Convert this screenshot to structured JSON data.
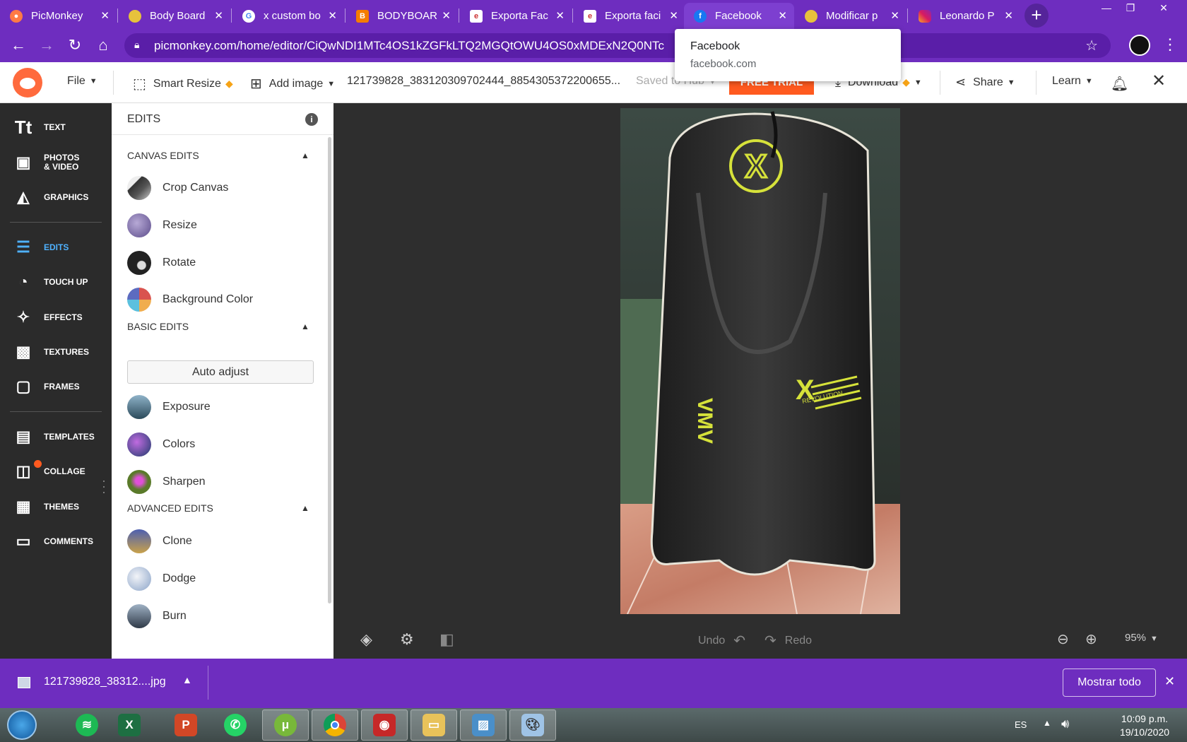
{
  "browser": {
    "tabs": [
      {
        "title": "PicMonkey",
        "favicon": "picmonkey-icon",
        "active": false
      },
      {
        "title": "Body Board",
        "favicon": "monkey-icon",
        "active": false
      },
      {
        "title": "x custom bo",
        "favicon": "google-icon",
        "active": false
      },
      {
        "title": "BODYBOAR",
        "favicon": "blogger-icon",
        "active": false
      },
      {
        "title": "Exporta Fac",
        "favicon": "exporta-icon",
        "active": false
      },
      {
        "title": "Exporta faci",
        "favicon": "exporta-icon",
        "active": false
      },
      {
        "title": "Facebook",
        "favicon": "facebook-icon",
        "active": true
      },
      {
        "title": "Modificar p",
        "favicon": "monkey-icon",
        "active": false
      },
      {
        "title": "Leonardo P",
        "favicon": "instagram-icon",
        "active": false
      }
    ],
    "url": "picmonkey.com/home/editor/CiQwNDI1MTc4OS1kZGFkLTQ2MGQtOWU4OS0xMDExN2Q0NTc",
    "tooltip": {
      "title": "Facebook",
      "domain": "facebook.com"
    }
  },
  "app": {
    "file_label": "File",
    "smart_resize_label": "Smart Resize",
    "add_image_label": "Add image",
    "filename": "121739828_383120309702444_8854305372200655...",
    "saved_label": "Saved to Hub",
    "free_trial_label": "FREE TRIAL",
    "download_label": "Download",
    "share_label": "Share",
    "learn_label": "Learn"
  },
  "leftnav": {
    "items": [
      {
        "label": "TEXT",
        "icon": "text-icon"
      },
      {
        "label": "PHOTOS\n& VIDEO",
        "icon": "photos-icon"
      },
      {
        "label": "GRAPHICS",
        "icon": "graphics-icon"
      },
      {
        "label": "EDITS",
        "icon": "sliders-icon",
        "active": true
      },
      {
        "label": "TOUCH UP",
        "icon": "face-icon"
      },
      {
        "label": "EFFECTS",
        "icon": "wand-icon"
      },
      {
        "label": "TEXTURES",
        "icon": "textures-icon"
      },
      {
        "label": "FRAMES",
        "icon": "frame-icon"
      },
      {
        "label": "TEMPLATES",
        "icon": "templates-icon"
      },
      {
        "label": "COLLAGE",
        "icon": "collage-icon"
      },
      {
        "label": "THEMES",
        "icon": "themes-icon"
      },
      {
        "label": "COMMENTS",
        "icon": "comments-icon"
      }
    ]
  },
  "panel": {
    "title": "EDITS",
    "sections": {
      "canvas": "CANVAS EDITS",
      "basic": "BASIC EDITS",
      "advanced": "ADVANCED EDITS"
    },
    "canvas_tools": [
      "Crop Canvas",
      "Resize",
      "Rotate",
      "Background Color"
    ],
    "auto_adjust": "Auto adjust",
    "basic_tools": [
      "Exposure",
      "Colors",
      "Sharpen"
    ],
    "advanced_tools": [
      "Clone",
      "Dodge",
      "Burn"
    ]
  },
  "canvas": {
    "undo_label": "Undo",
    "redo_label": "Redo",
    "zoom": "95%",
    "photo_marks": {
      "nose_logo": "X",
      "left_text": "VMV",
      "right_text": "REVOLUTION"
    }
  },
  "downloads": {
    "filename": "121739828_38312....jpg",
    "show_all": "Mostrar todo"
  },
  "taskbar": {
    "lang": "ES",
    "time": "10:09 p.m.",
    "date": "19/10/2020",
    "apps": [
      "spotify-icon",
      "excel-icon",
      "powerpoint-icon",
      "whatsapp-icon",
      "utorrent-icon",
      "chrome-icon",
      "camera-icon",
      "explorer-icon",
      "photos-viewer-icon",
      "paint-icon"
    ]
  },
  "colors": {
    "chrome_purple": "#6e2dbf",
    "accent_blue": "#4fb2ff",
    "free_trial_orange": "#ff5a1f"
  }
}
